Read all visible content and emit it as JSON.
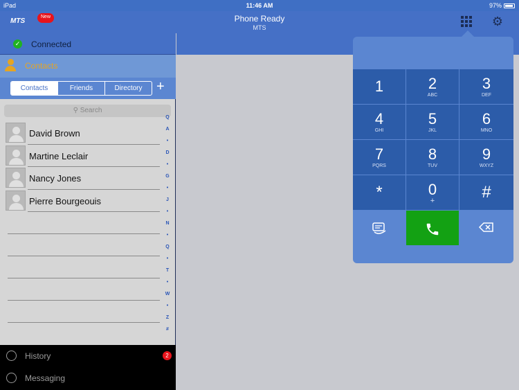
{
  "status": {
    "device": "iPad",
    "time": "11:46 AM",
    "battery": "97%"
  },
  "header": {
    "logo": "MTS",
    "new_badge": "New",
    "title": "Phone Ready",
    "subtitle": "MTS"
  },
  "left": {
    "connected": "Connected",
    "contacts_label": "Contacts",
    "tabs": [
      "Contacts",
      "Friends",
      "Directory"
    ],
    "add": "+",
    "search_placeholder": "Search",
    "contacts": [
      "David Brown",
      "Martine Leclair",
      "Nancy Jones",
      "Pierre Bourgeouis"
    ],
    "index": [
      "Q",
      "A",
      "•",
      "D",
      "•",
      "G",
      "•",
      "J",
      "•",
      "N",
      "•",
      "Q",
      "•",
      "T",
      "•",
      "W",
      "•",
      "Z",
      "#"
    ],
    "nav": {
      "history": "History",
      "history_badge": "2",
      "messaging": "Messaging"
    }
  },
  "keypad": {
    "keys": [
      {
        "digit": "1",
        "sub": ""
      },
      {
        "digit": "2",
        "sub": "ABC"
      },
      {
        "digit": "3",
        "sub": "DEF"
      },
      {
        "digit": "4",
        "sub": "GHI"
      },
      {
        "digit": "5",
        "sub": "JKL"
      },
      {
        "digit": "6",
        "sub": "MNO"
      },
      {
        "digit": "7",
        "sub": "PQRS"
      },
      {
        "digit": "8",
        "sub": "TUV"
      },
      {
        "digit": "9",
        "sub": "WXYZ"
      },
      {
        "digit": "*",
        "sub": ""
      },
      {
        "digit": "0",
        "sub": "+"
      },
      {
        "digit": "#",
        "sub": ""
      }
    ],
    "icons": {
      "left": "voicemail-icon",
      "center": "phone-icon",
      "right": "backspace-icon"
    }
  },
  "colors": {
    "header": "#4570c6",
    "key": "#2c5ca9",
    "call": "#13a113",
    "accent": "#e6a522"
  }
}
